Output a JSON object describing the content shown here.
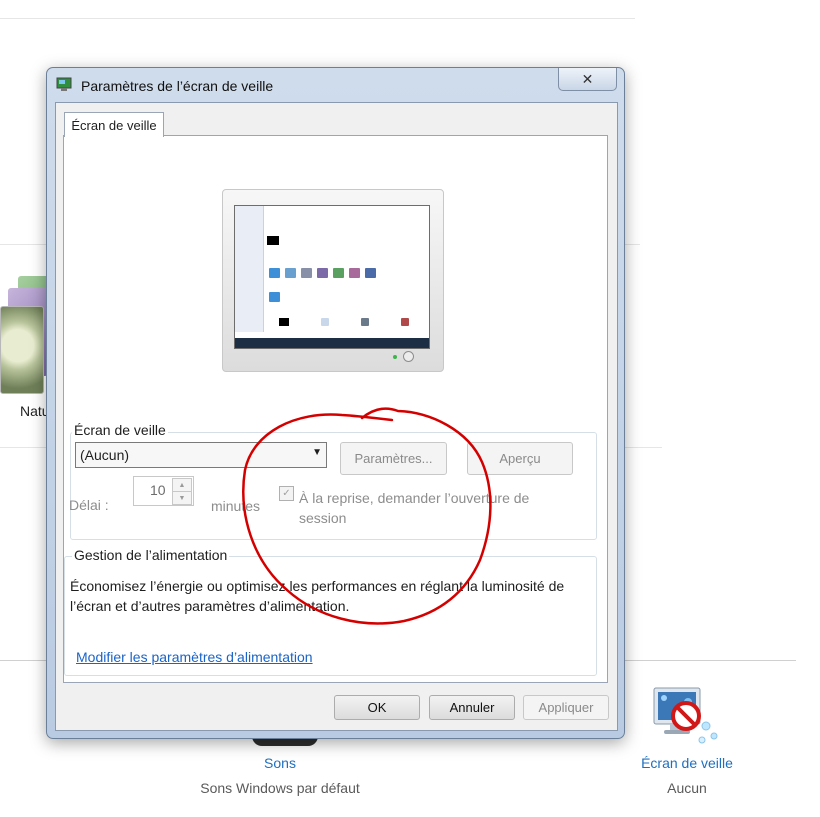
{
  "background": {
    "theme_label": "Natu",
    "sounds": {
      "title": "Sons",
      "subtitle": "Sons Windows par défaut"
    },
    "screensaver": {
      "title": "Écran de veille",
      "subtitle": "Aucun"
    }
  },
  "dialog": {
    "title": "Paramètres de l’écran de veille",
    "close_glyph": "✕",
    "tab_label": "Écran de veille",
    "screensaver_group": {
      "legend": "Écran de veille",
      "selected": "(Aucun)",
      "settings_button": "Paramètres...",
      "preview_button": "Aperçu",
      "delay_label": "Délai :",
      "delay_value": "10",
      "minutes_label": "minutes",
      "resume_label": "À la reprise, demander l’ouverture de session"
    },
    "power_group": {
      "legend": "Gestion de l’alimentation",
      "text": "Économisez l’énergie ou optimisez les performances en réglant la luminosité de l’écran et d’autres paramètres d’alimentation.",
      "link": "Modifier les paramètres d’alimentation"
    },
    "buttons": {
      "ok": "OK",
      "cancel": "Annuler",
      "apply": "Appliquer"
    }
  },
  "colors": {
    "link": "#1a64c8",
    "annotation": "#d40000"
  }
}
